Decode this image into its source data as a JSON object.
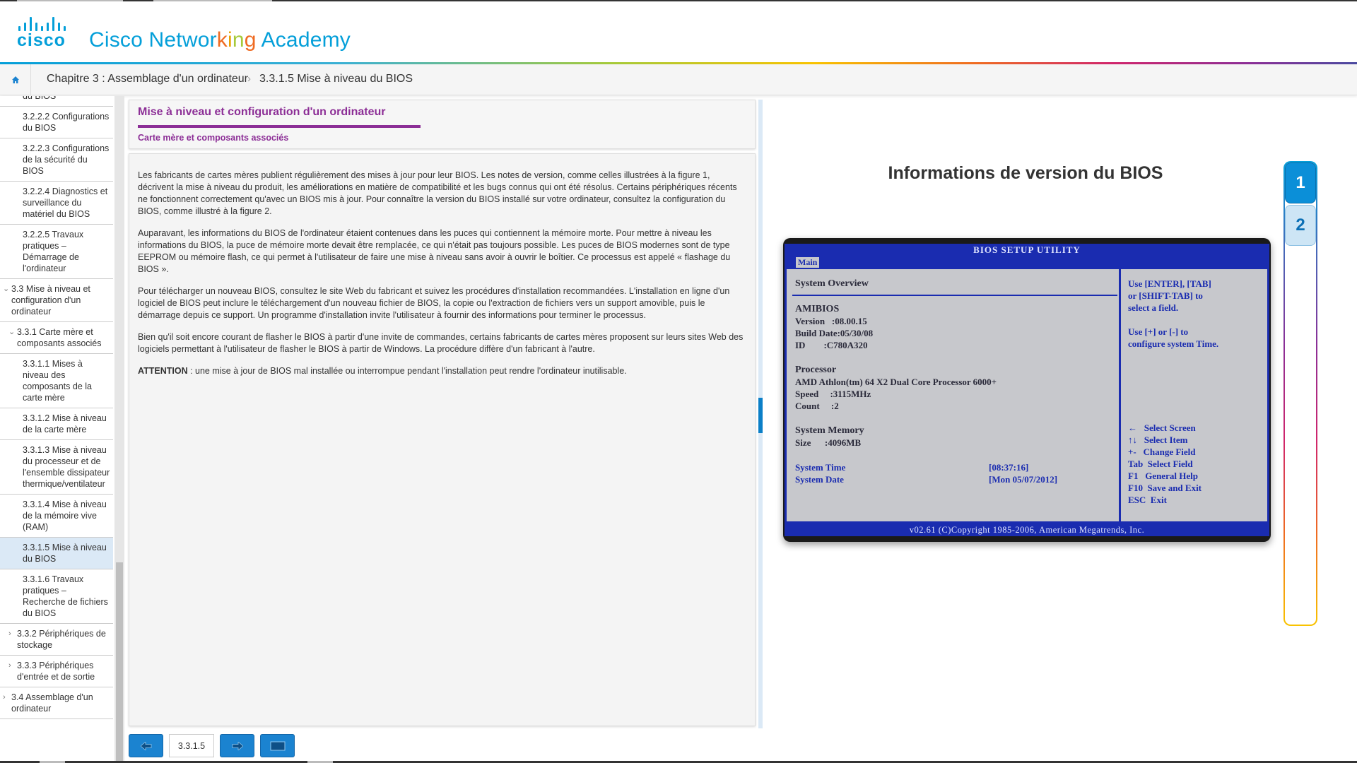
{
  "header": {
    "brand_prefix": "Cisco Networ",
    "brand_k": "k",
    "brand_i": "i",
    "brand_n": "n",
    "brand_g": "g",
    "brand_suffix": " Academy",
    "logo_word": "cisco",
    "brand_color": "#049fd9"
  },
  "breadcrumb": {
    "home_icon": "home-icon",
    "chapter": "Chapitre 3 : Assemblage d'un ordinateur",
    "separator": "›",
    "page": "3.3.1.5 Mise à niveau du BIOS"
  },
  "sidebar": {
    "items": [
      {
        "label": "du BIOS",
        "level": 3
      },
      {
        "label": "3.2.2.2 Configurations du BIOS",
        "level": 3
      },
      {
        "label": "3.2.2.3 Configurations de la sécurité du BIOS",
        "level": 3
      },
      {
        "label": "3.2.2.4 Diagnostics et surveillance du matériel du BIOS",
        "level": 3
      },
      {
        "label": "3.2.2.5 Travaux pratiques – Démarrage de l'ordinateur",
        "level": 3
      },
      {
        "label": "3.3 Mise à niveau et configuration d'un ordinateur",
        "level": 1,
        "chevron": "⌄"
      },
      {
        "label": "3.3.1 Carte mère et composants associés",
        "level": 2,
        "chevron": "⌄"
      },
      {
        "label": "3.3.1.1 Mises à niveau des composants de la carte mère",
        "level": 3
      },
      {
        "label": "3.3.1.2 Mise à niveau de la carte mère",
        "level": 3
      },
      {
        "label": "3.3.1.3 Mise à niveau du processeur et de l'ensemble dissipateur thermique/ventilateur",
        "level": 3
      },
      {
        "label": "3.3.1.4 Mise à niveau de la mémoire vive (RAM)",
        "level": 3
      },
      {
        "label": "3.3.1.5 Mise à niveau du BIOS",
        "level": 3,
        "active": true
      },
      {
        "label": "3.3.1.6 Travaux pratiques – Recherche de fichiers du BIOS",
        "level": 3
      },
      {
        "label": "3.3.2 Périphériques de stockage",
        "level": 2,
        "chevron": "›"
      },
      {
        "label": "3.3.3 Périphériques d'entrée et de sortie",
        "level": 2,
        "chevron": "›"
      },
      {
        "label": "3.4 Assemblage d'un ordinateur",
        "level": 1,
        "chevron": "›"
      }
    ]
  },
  "main": {
    "title": "Mise à niveau et configuration d'un ordinateur",
    "subtitle": "Carte mère et composants associés",
    "paragraphs": [
      "Les fabricants de cartes mères publient régulièrement des mises à jour pour leur BIOS. Les notes de version, comme celles illustrées à la figure 1, décrivent la mise à niveau du produit, les améliorations en matière de compatibilité et les bugs connus qui ont été résolus. Certains périphériques récents ne fonctionnent correctement qu'avec un BIOS mis à jour. Pour connaître la version du BIOS installé sur votre ordinateur, consultez la configuration du BIOS, comme illustré à la figure 2.",
      "Auparavant, les informations du BIOS de l'ordinateur étaient contenues dans les puces qui contiennent la mémoire morte. Pour mettre à niveau les informations du BIOS, la puce de mémoire morte devait être remplacée, ce qui n'était pas toujours possible. Les puces de BIOS modernes sont de type EEPROM ou mémoire flash, ce qui permet à l'utilisateur de faire une mise à niveau sans avoir à ouvrir le boîtier. Ce processus est appelé « flashage du BIOS ».",
      "Pour télécharger un nouveau BIOS, consultez le site Web du fabricant et suivez les procédures d'installation recommandées. L'installation en ligne d'un logiciel de BIOS peut inclure le téléchargement d'un nouveau fichier de BIOS, la copie ou l'extraction de fichiers vers un support amovible, puis le démarrage depuis ce support. Un programme d'installation invite l'utilisateur à fournir des informations pour terminer le processus.",
      "Bien qu'il soit encore courant de flasher le BIOS à partir d'une invite de commandes, certains fabricants de cartes mères proposent sur leurs sites Web des logiciels permettant à l'utilisateur de flasher le BIOS à partir de Windows. La procédure diffère d'un fabricant à l'autre."
    ],
    "attention_label": "ATTENTION",
    "attention_text": " : une mise à jour de BIOS mal installée ou interrompue pendant l'installation peut rendre l'ordinateur inutilisable."
  },
  "bottom_nav": {
    "prev_icon": "arrow-left-icon",
    "page_number": "3.3.1.5",
    "next_icon": "arrow-right-icon",
    "view_icon": "fullscreen-icon"
  },
  "figure": {
    "title": "Informations de version du BIOS",
    "tabs": [
      "1",
      "2"
    ],
    "active_tab": "1",
    "bios": {
      "header": "BIOS SETUP UTILITY",
      "tab": "Main",
      "section": "System Overview",
      "amibios_label": "AMIBIOS",
      "version_line": "Version   :08.00.15",
      "build_line": "Build Date:05/30/08",
      "id_line": "ID        :C780A320",
      "processor_label": "Processor",
      "cpu_line": "AMD Athlon(tm) 64 X2 Dual Core Processor 6000+",
      "speed_line": "Speed     :3115MHz",
      "count_line": "Count     :2",
      "memory_label": "System Memory",
      "size_line": "Size      :4096MB",
      "time_label": "System Time",
      "time_value": "[08:37:16]",
      "date_label": "System Date",
      "date_value": "[Mon 05/07/2012]",
      "help1": "Use [ENTER], [TAB]\nor [SHIFT-TAB] to\nselect a field.",
      "help2": "Use [+] or [-] to\nconfigure system Time.",
      "keys": "←   Select Screen\n↑↓   Select Item\n+-   Change Field\nTab  Select Field\nF1   General Help\nF10  Save and Exit\nESC  Exit",
      "footer": "v02.61 (C)Copyright 1985-2006, American Megatrends, Inc."
    }
  }
}
